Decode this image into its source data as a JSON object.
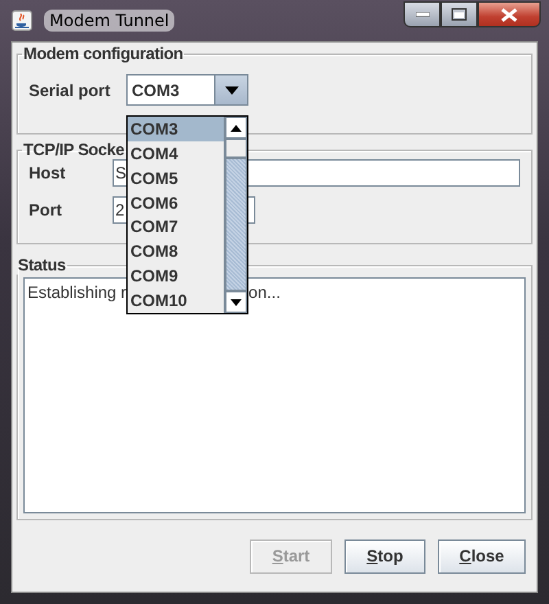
{
  "window": {
    "title": "Modem Tunnel"
  },
  "modem_configuration": {
    "title": "Modem configuration",
    "serial_port": {
      "label": "Serial port",
      "value": "COM3",
      "expanded": true,
      "options": [
        {
          "label": "COM3",
          "selected": true
        },
        {
          "label": "COM4",
          "selected": false
        },
        {
          "label": "COM5",
          "selected": false
        },
        {
          "label": "COM6",
          "selected": false
        },
        {
          "label": "COM7",
          "selected": false
        },
        {
          "label": "COM8",
          "selected": false
        },
        {
          "label": "COM9",
          "selected": false
        },
        {
          "label": "COM10",
          "selected": false
        }
      ]
    }
  },
  "tcp_ip_socket": {
    "title": "TCP/IP Socke",
    "host": {
      "label": "Host",
      "value": "S"
    },
    "port": {
      "label": "Port",
      "value": "2"
    }
  },
  "status": {
    "title": "Status",
    "text_fragments": [
      "Establishing r",
      "on..."
    ]
  },
  "buttons": [
    {
      "label": "Start",
      "disabled": true
    },
    {
      "label": "Stop",
      "disabled": false
    },
    {
      "label": "Close",
      "disabled": false
    }
  ]
}
